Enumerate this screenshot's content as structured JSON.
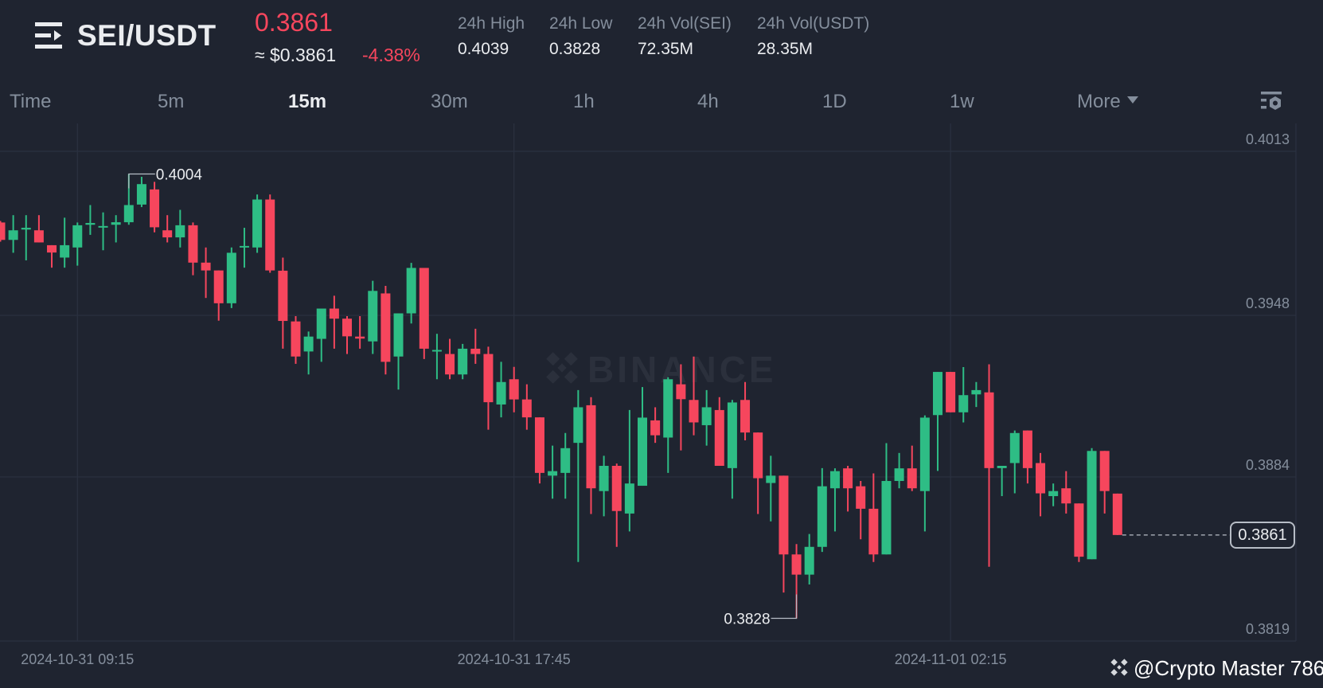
{
  "header": {
    "pair": "SEI/USDT",
    "last_price": "0.3861",
    "fiat_price": "≈ $0.3861",
    "change_pct": "-4.38%",
    "stats": [
      {
        "label": "24h High",
        "value": "0.4039"
      },
      {
        "label": "24h Low",
        "value": "0.3828"
      },
      {
        "label": "24h Vol(SEI)",
        "value": "72.35M"
      },
      {
        "label": "24h Vol(USDT)",
        "value": "28.35M"
      }
    ]
  },
  "tabs": [
    {
      "label": "Time",
      "active": false
    },
    {
      "label": "5m",
      "active": false
    },
    {
      "label": "15m",
      "active": true
    },
    {
      "label": "30m",
      "active": false
    },
    {
      "label": "1h",
      "active": false
    },
    {
      "label": "4h",
      "active": false
    },
    {
      "label": "1D",
      "active": false
    },
    {
      "label": "1w",
      "active": false
    },
    {
      "label": "More",
      "active": false
    }
  ],
  "icons": {
    "menu": "menu-icon",
    "settings": "chart-settings-icon",
    "more": "caret-down-icon"
  },
  "watermark": {
    "brand": "BINANCE",
    "credit": "@Crypto Master 786"
  },
  "colors": {
    "up": "#2ebd85",
    "down": "#f6465d",
    "background": "#1f2430",
    "grid": "#2b3140"
  },
  "chart_data": {
    "type": "candlestick",
    "interval": "15m",
    "title": "SEI/USDT",
    "y_ticks": [
      "0.4013",
      "0.3948",
      "0.3884",
      "0.3819"
    ],
    "ylim": [
      0.3819,
      0.4013
    ],
    "x_ticks": [
      {
        "label": "2024-10-31 09:15",
        "index": 6
      },
      {
        "label": "2024-10-31 17:45",
        "index": 40
      },
      {
        "label": "2024-11-01 02:15",
        "index": 74
      }
    ],
    "current_price": "0.3861",
    "high_annotation": {
      "label": "0.4004",
      "index": 10,
      "value": 0.4004
    },
    "low_annotation": {
      "label": "0.3828",
      "index": 62,
      "value": 0.3828
    },
    "ohlc": [
      [
        0.39848,
        0.39854,
        0.39772,
        0.39779
      ],
      [
        0.39779,
        0.39877,
        0.39728,
        0.39817
      ],
      [
        0.3982,
        0.39877,
        0.39698,
        0.39827
      ],
      [
        0.39817,
        0.39877,
        0.39769,
        0.39769
      ],
      [
        0.39758,
        0.39758,
        0.39669,
        0.39729
      ],
      [
        0.39709,
        0.39867,
        0.39669,
        0.39758
      ],
      [
        0.39749,
        0.39848,
        0.39677,
        0.39837
      ],
      [
        0.39839,
        0.39917,
        0.39799,
        0.39846
      ],
      [
        0.39829,
        0.39888,
        0.39738,
        0.39834
      ],
      [
        0.39839,
        0.39877,
        0.39769,
        0.39849
      ],
      [
        0.39849,
        0.4004,
        0.39839,
        0.39917
      ],
      [
        0.39919,
        0.40029,
        0.39909,
        0.4
      ],
      [
        0.39979,
        0.40009,
        0.39809,
        0.39829
      ],
      [
        0.39817,
        0.39877,
        0.39769,
        0.39789
      ],
      [
        0.39789,
        0.39898,
        0.39749,
        0.39837
      ],
      [
        0.39837,
        0.39848,
        0.39639,
        0.39689
      ],
      [
        0.39689,
        0.39749,
        0.39549,
        0.39658
      ],
      [
        0.39658,
        0.39658,
        0.39459,
        0.39528
      ],
      [
        0.39528,
        0.39749,
        0.39509,
        0.39728
      ],
      [
        0.3975,
        0.39827,
        0.39669,
        0.39755
      ],
      [
        0.39749,
        0.39959,
        0.39728,
        0.39939
      ],
      [
        0.39939,
        0.39959,
        0.39649,
        0.39658
      ],
      [
        0.39657,
        0.39709,
        0.39348,
        0.39458
      ],
      [
        0.39456,
        0.39477,
        0.39288,
        0.39317
      ],
      [
        0.39337,
        0.39416,
        0.39246,
        0.39396
      ],
      [
        0.39387,
        0.39507,
        0.39296,
        0.39507
      ],
      [
        0.39507,
        0.39558,
        0.39348,
        0.39467
      ],
      [
        0.39467,
        0.39477,
        0.39327,
        0.39397
      ],
      [
        0.39396,
        0.39477,
        0.39348,
        0.39388
      ],
      [
        0.39377,
        0.39617,
        0.39327,
        0.39577
      ],
      [
        0.39567,
        0.39597,
        0.39246,
        0.39296
      ],
      [
        0.39317,
        0.39488,
        0.39186,
        0.39488
      ],
      [
        0.39488,
        0.39688,
        0.39448,
        0.39668
      ],
      [
        0.39668,
        0.39668,
        0.39307,
        0.39348
      ],
      [
        0.39337,
        0.39407,
        0.39227,
        0.39343
      ],
      [
        0.39327,
        0.39387,
        0.39227,
        0.39246
      ],
      [
        0.39246,
        0.39367,
        0.39227,
        0.39348
      ],
      [
        0.39348,
        0.39427,
        0.39288,
        0.39327
      ],
      [
        0.39327,
        0.39356,
        0.39027,
        0.39136
      ],
      [
        0.39127,
        0.39296,
        0.39076,
        0.39216
      ],
      [
        0.39227,
        0.39276,
        0.39096,
        0.39147
      ],
      [
        0.39147,
        0.39207,
        0.39027,
        0.39076
      ],
      [
        0.39076,
        0.39076,
        0.38814,
        0.38856
      ],
      [
        0.38845,
        0.38964,
        0.38754,
        0.38863
      ],
      [
        0.38856,
        0.39014,
        0.38754,
        0.38954
      ],
      [
        0.38975,
        0.39184,
        0.38503,
        0.39116
      ],
      [
        0.39124,
        0.39156,
        0.38693,
        0.38795
      ],
      [
        0.38784,
        0.38924,
        0.38684,
        0.38884
      ],
      [
        0.38884,
        0.38893,
        0.38563,
        0.38705
      ],
      [
        0.38695,
        0.39105,
        0.38624,
        0.38814
      ],
      [
        0.38805,
        0.39196,
        0.38805,
        0.39075
      ],
      [
        0.39064,
        0.39116,
        0.38975,
        0.39005
      ],
      [
        0.38996,
        0.39235,
        0.38856,
        0.39227
      ],
      [
        0.39207,
        0.39286,
        0.38945,
        0.39148
      ],
      [
        0.39145,
        0.39317,
        0.39005,
        0.39056
      ],
      [
        0.39045,
        0.39184,
        0.38964,
        0.39116
      ],
      [
        0.39105,
        0.39156,
        0.38884,
        0.38884
      ],
      [
        0.38875,
        0.39145,
        0.38754,
        0.39135
      ],
      [
        0.39145,
        0.39216,
        0.38985,
        0.39016
      ],
      [
        0.39016,
        0.39016,
        0.38693,
        0.38835
      ],
      [
        0.38816,
        0.38924,
        0.38664,
        0.38845
      ],
      [
        0.38845,
        0.38845,
        0.38382,
        0.38533
      ],
      [
        0.38533,
        0.38574,
        0.3828,
        0.38453
      ],
      [
        0.38453,
        0.38614,
        0.38414,
        0.38563
      ],
      [
        0.38563,
        0.38875,
        0.38543,
        0.38803
      ],
      [
        0.38795,
        0.38874,
        0.38624,
        0.38863
      ],
      [
        0.38874,
        0.38884,
        0.38703,
        0.38795
      ],
      [
        0.38803,
        0.38824,
        0.38593,
        0.38714
      ],
      [
        0.38714,
        0.38854,
        0.38503,
        0.38533
      ],
      [
        0.38533,
        0.38974,
        0.38533,
        0.38824
      ],
      [
        0.38824,
        0.38935,
        0.38795,
        0.38874
      ],
      [
        0.38874,
        0.38964,
        0.38784,
        0.38795
      ],
      [
        0.38784,
        0.39084,
        0.38624,
        0.39075
      ],
      [
        0.39085,
        0.39256,
        0.38864,
        0.39256
      ],
      [
        0.39256,
        0.39256,
        0.39096,
        0.39096
      ],
      [
        0.39096,
        0.39275,
        0.39056,
        0.39164
      ],
      [
        0.39167,
        0.39216,
        0.39117,
        0.39184
      ],
      [
        0.39175,
        0.39286,
        0.38484,
        0.38875
      ],
      [
        0.38875,
        0.38884,
        0.38764,
        0.38884
      ],
      [
        0.38895,
        0.39024,
        0.38775,
        0.39014
      ],
      [
        0.39024,
        0.39024,
        0.38814,
        0.38875
      ],
      [
        0.38895,
        0.38935,
        0.38684,
        0.38775
      ],
      [
        0.38764,
        0.38814,
        0.38724,
        0.38784
      ],
      [
        0.38795,
        0.38863,
        0.38695,
        0.38735
      ],
      [
        0.38735,
        0.38735,
        0.38503,
        0.38524
      ],
      [
        0.38514,
        0.38954,
        0.38514,
        0.38943
      ],
      [
        0.38943,
        0.38943,
        0.38695,
        0.38784
      ],
      [
        0.38774,
        0.38774,
        0.3861,
        0.3861
      ]
    ]
  }
}
